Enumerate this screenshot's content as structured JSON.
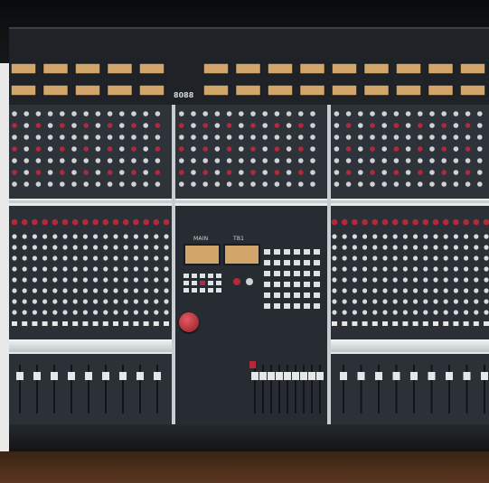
{
  "scene": {
    "description_label": "",
    "palette": {
      "wall": "#0b0c0d",
      "console_body": "#2a3035",
      "module_face": "#2d3339",
      "module_face_dark": "#22272c",
      "meter_bridge": "#1f2327",
      "vu_face": "#d2a56b",
      "divider": "#c9cdd1",
      "chrome": "#d6dadd",
      "accent_red": "#b3283a",
      "accent_green": "#2f7d53",
      "wood_floor": "#4a2d1a",
      "fader_cap": "#e4e6e8"
    }
  },
  "center_section": {
    "brand_badge": "8088",
    "meter_labels": [
      "MAIN",
      "TB1"
    ]
  },
  "bottom_labels": {
    "left": "",
    "right": ""
  }
}
